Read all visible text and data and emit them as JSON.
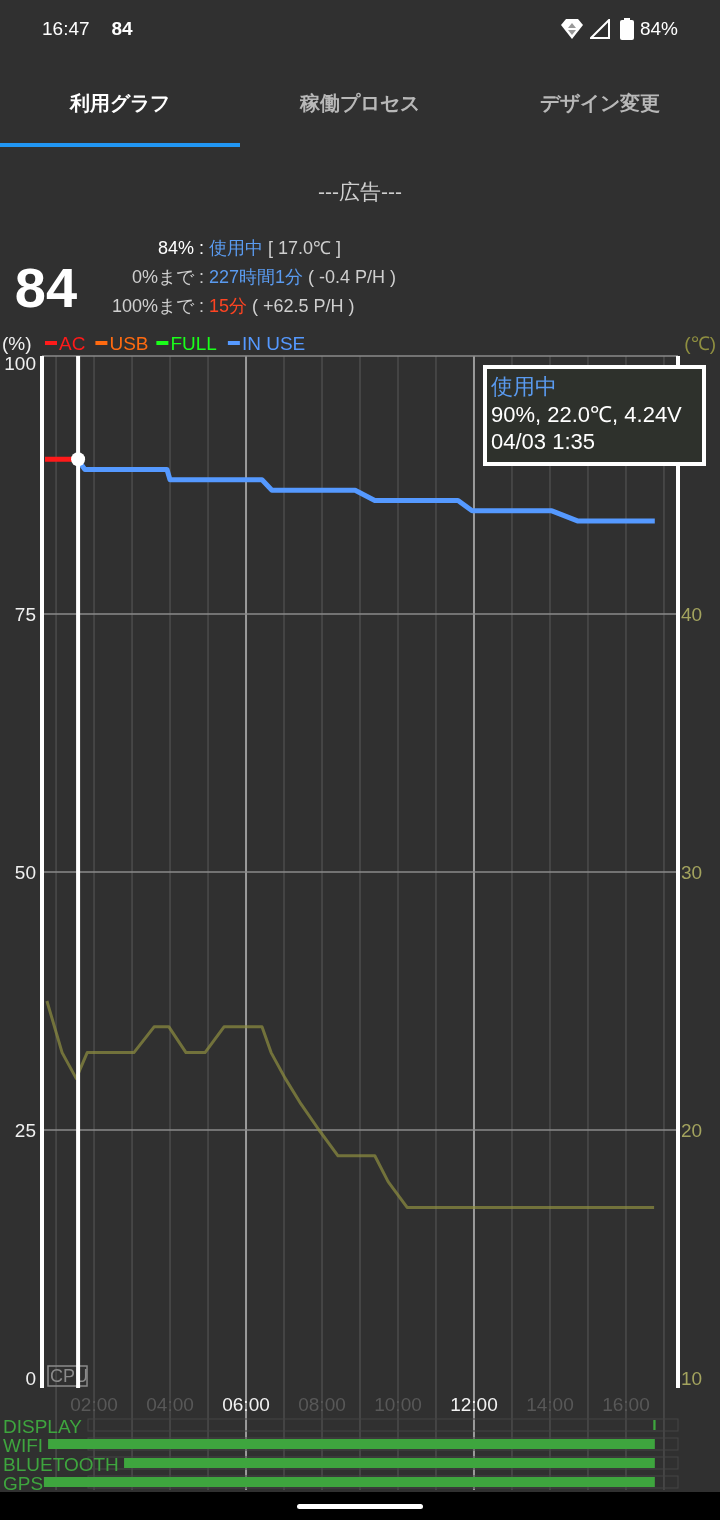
{
  "status_bar": {
    "time": "16:47",
    "notification": "84",
    "battery": "84%"
  },
  "tabs": [
    {
      "label": "利用グラフ",
      "selected": true
    },
    {
      "label": "稼働プロセス",
      "selected": false
    },
    {
      "label": "デザイン変更",
      "selected": false
    }
  ],
  "ad": "---広告---",
  "summary": {
    "level": "84",
    "rows": [
      {
        "label": "84% :",
        "value": "使用中",
        "kind": "info",
        "detail": "[ 17.0℃ ]"
      },
      {
        "label": "0%まで :",
        "value": "227時間1分",
        "kind": "info",
        "detail": "( -0.4 P/H )"
      },
      {
        "label": "100%まで :",
        "value": "15分",
        "kind": "charge",
        "detail": "( +62.5 P/H )"
      }
    ]
  },
  "chart": {
    "chart_data": {
      "type": "line",
      "ylabel": "(%)",
      "grid": true,
      "legend": "top-left",
      "xlim": [
        0.63,
        17.37
      ],
      "ylim": [
        0,
        100
      ],
      "y2lim": [
        10,
        50
      ],
      "xticks": [
        {
          "value": 2,
          "label": "02:00"
        },
        {
          "value": 4,
          "label": "04:00"
        },
        {
          "value": 6,
          "label": "06:00"
        },
        {
          "value": 8,
          "label": "08:00"
        },
        {
          "value": 10,
          "label": "10:00"
        },
        {
          "value": 12,
          "label": "12:00"
        },
        {
          "value": 14,
          "label": "14:00"
        },
        {
          "value": 16,
          "label": "16:00"
        }
      ],
      "yticks": [
        0,
        25,
        50,
        75,
        100
      ],
      "y2ticks": [
        10,
        20,
        30,
        40
      ],
      "series": [
        {
          "name": "AC",
          "color": "#ff1a1a",
          "x": [
            0.71,
            1.58
          ],
          "values": [
            90,
            90
          ]
        },
        {
          "name": "USB",
          "color": "#ff6a10",
          "values": [
            null
          ]
        },
        {
          "name": "FULL",
          "color": "#1aff1a",
          "values": [
            null
          ]
        },
        {
          "name": "IN USE",
          "color": "#5599ff",
          "x": [
            1.6,
            1.76,
            3.92,
            4.0,
            6.42,
            6.68,
            8.87,
            9.39,
            11.58,
            11.95,
            14.05,
            14.74,
            16.76
          ],
          "values": [
            89.8,
            89,
            89,
            88,
            88,
            87,
            87,
            86,
            86,
            85,
            85,
            84,
            84
          ]
        },
        {
          "name": "(℃)",
          "color": "#8f8f40",
          "axis": "y2",
          "x": [
            0.76,
            1.16,
            1.53,
            1.82,
            3.05,
            3.58,
            3.97,
            4.42,
            4.92,
            5.42,
            6.42,
            6.66,
            7.03,
            7.45,
            7.92,
            8.42,
            9.39,
            9.74,
            10.24,
            16.74
          ],
          "values": [
            25,
            23,
            22,
            23,
            23,
            24,
            24,
            23,
            23,
            24,
            24,
            23,
            22,
            21,
            20,
            19,
            19,
            18,
            17,
            17
          ]
        }
      ],
      "ref_lines": [
        {
          "axis": "x",
          "value": 1.58
        }
      ],
      "annotations": [
        "使用中"
      ]
    },
    "x_tick_styles": [
      {
        "highlighted": false
      },
      {
        "highlighted": false
      },
      {
        "highlighted": true
      },
      {
        "highlighted": false
      },
      {
        "highlighted": false
      },
      {
        "highlighted": true
      },
      {
        "highlighted": false
      },
      {
        "highlighted": false
      }
    ],
    "tooltip_lines": [
      "90%, 22.0℃, 4.24V",
      "04/03 1:35"
    ],
    "overlay_label": "CPU"
  },
  "activity": {
    "rows": [
      {
        "label": "DISPLAY"
      },
      {
        "label": "WIFI"
      },
      {
        "label": "BLUETOOTH"
      },
      {
        "label": "GPS"
      }
    ]
  }
}
